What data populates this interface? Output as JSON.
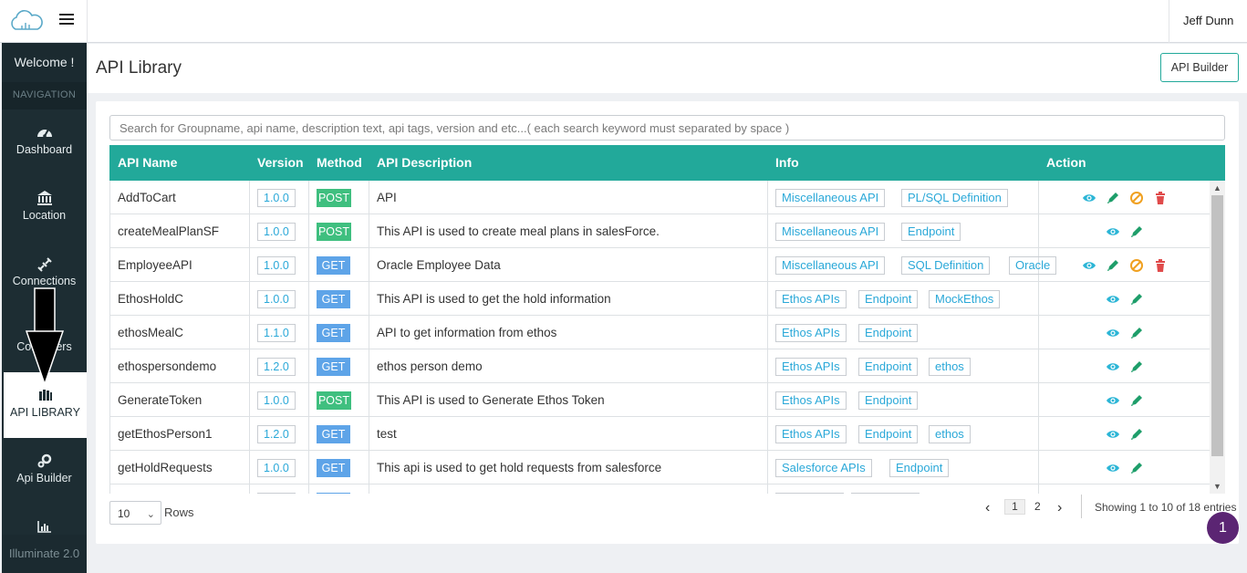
{
  "topbar": {
    "user_name": "Jeff Dunn"
  },
  "sidebar": {
    "welcome": "Welcome !",
    "nav_label": "NAVIGATION",
    "items": [
      {
        "label": "Dashboard",
        "icon": "dashboard-icon"
      },
      {
        "label": "Location",
        "icon": "bank-icon"
      },
      {
        "label": "Connections",
        "icon": "plug-icon"
      },
      {
        "label": "Containers",
        "icon": "container-icon"
      },
      {
        "label": "API LIBRARY",
        "icon": "library-icon",
        "active": true
      },
      {
        "label": "Api Builder",
        "icon": "gears-icon"
      },
      {
        "label": "Analytics",
        "icon": "chart-icon"
      }
    ],
    "footer": "Illuminate 2.0"
  },
  "header": {
    "title": "API Library",
    "builder_button": "API Builder"
  },
  "search": {
    "placeholder": "Search for Groupname, api name, description text, api tags, version and etc...( each search keyword must separated by space )"
  },
  "table": {
    "columns": [
      "API Name",
      "Version",
      "Method",
      "API Description",
      "Info",
      "Action"
    ],
    "rows": [
      {
        "name": "AddToCart",
        "version": "1.0.0",
        "method": "POST",
        "description": "API",
        "tags": [
          "Miscellaneous API",
          "PL/SQL Definition"
        ],
        "actions": [
          "view",
          "edit",
          "disable",
          "delete"
        ]
      },
      {
        "name": "createMealPlanSF",
        "version": "1.0.0",
        "method": "POST",
        "description": "This API is used to create meal plans in salesForce.",
        "tags": [
          "Miscellaneous API",
          "Endpoint"
        ],
        "actions": [
          "view",
          "edit"
        ]
      },
      {
        "name": "EmployeeAPI",
        "version": "1.0.0",
        "method": "GET",
        "description": "Oracle Employee Data",
        "tags": [
          "Miscellaneous API",
          "SQL Definition",
          "Oracle"
        ],
        "actions": [
          "view",
          "edit",
          "disable",
          "delete"
        ]
      },
      {
        "name": "EthosHoldC",
        "version": "1.0.0",
        "method": "GET",
        "description": "This API is used to get the hold information",
        "tags": [
          "Ethos APIs",
          "Endpoint",
          "MockEthos"
        ],
        "actions": [
          "view",
          "edit"
        ]
      },
      {
        "name": "ethosMealC",
        "version": "1.1.0",
        "method": "GET",
        "description": "API to get information from ethos",
        "tags": [
          "Ethos APIs",
          "Endpoint"
        ],
        "actions": [
          "view",
          "edit"
        ]
      },
      {
        "name": "ethospersondemo",
        "version": "1.2.0",
        "method": "GET",
        "description": "ethos person demo",
        "tags": [
          "Ethos APIs",
          "Endpoint",
          "ethos"
        ],
        "actions": [
          "view",
          "edit"
        ]
      },
      {
        "name": "GenerateToken",
        "version": "1.0.0",
        "method": "POST",
        "description": "This API is used to Generate Ethos Token",
        "tags": [
          "Ethos APIs",
          "Endpoint"
        ],
        "actions": [
          "view",
          "edit"
        ]
      },
      {
        "name": "getEthosPerson1",
        "version": "1.2.0",
        "method": "GET",
        "description": "test",
        "tags": [
          "Ethos APIs",
          "Endpoint",
          "ethos"
        ],
        "actions": [
          "view",
          "edit"
        ]
      },
      {
        "name": "getHoldRequests",
        "version": "1.0.0",
        "method": "GET",
        "description": "This api is used to get hold requests from salesforce",
        "tags": [
          "Salesforce APIs",
          "Endpoint"
        ],
        "actions": [
          "view",
          "edit"
        ]
      },
      {
        "name": "",
        "version": "",
        "method": "GET",
        "description": "",
        "tags": [
          "",
          ""
        ],
        "actions": []
      }
    ]
  },
  "footer": {
    "rows_value": "10",
    "rows_label": "Rows",
    "pages": [
      "1",
      "2"
    ],
    "showing": "Showing 1 to 10 of 18 entries"
  },
  "notification_count": "1",
  "colors": {
    "accent": "#22a99a",
    "sidebar": "#1d2d33",
    "post": "#3fbf7f",
    "get": "#5ea4e8",
    "link": "#2aa8d8",
    "view_icon": "#2bb5d6",
    "edit_icon": "#1e9e6a",
    "disable_icon": "#f0a020",
    "delete_icon": "#e04b4b",
    "badge": "#5b2573"
  }
}
